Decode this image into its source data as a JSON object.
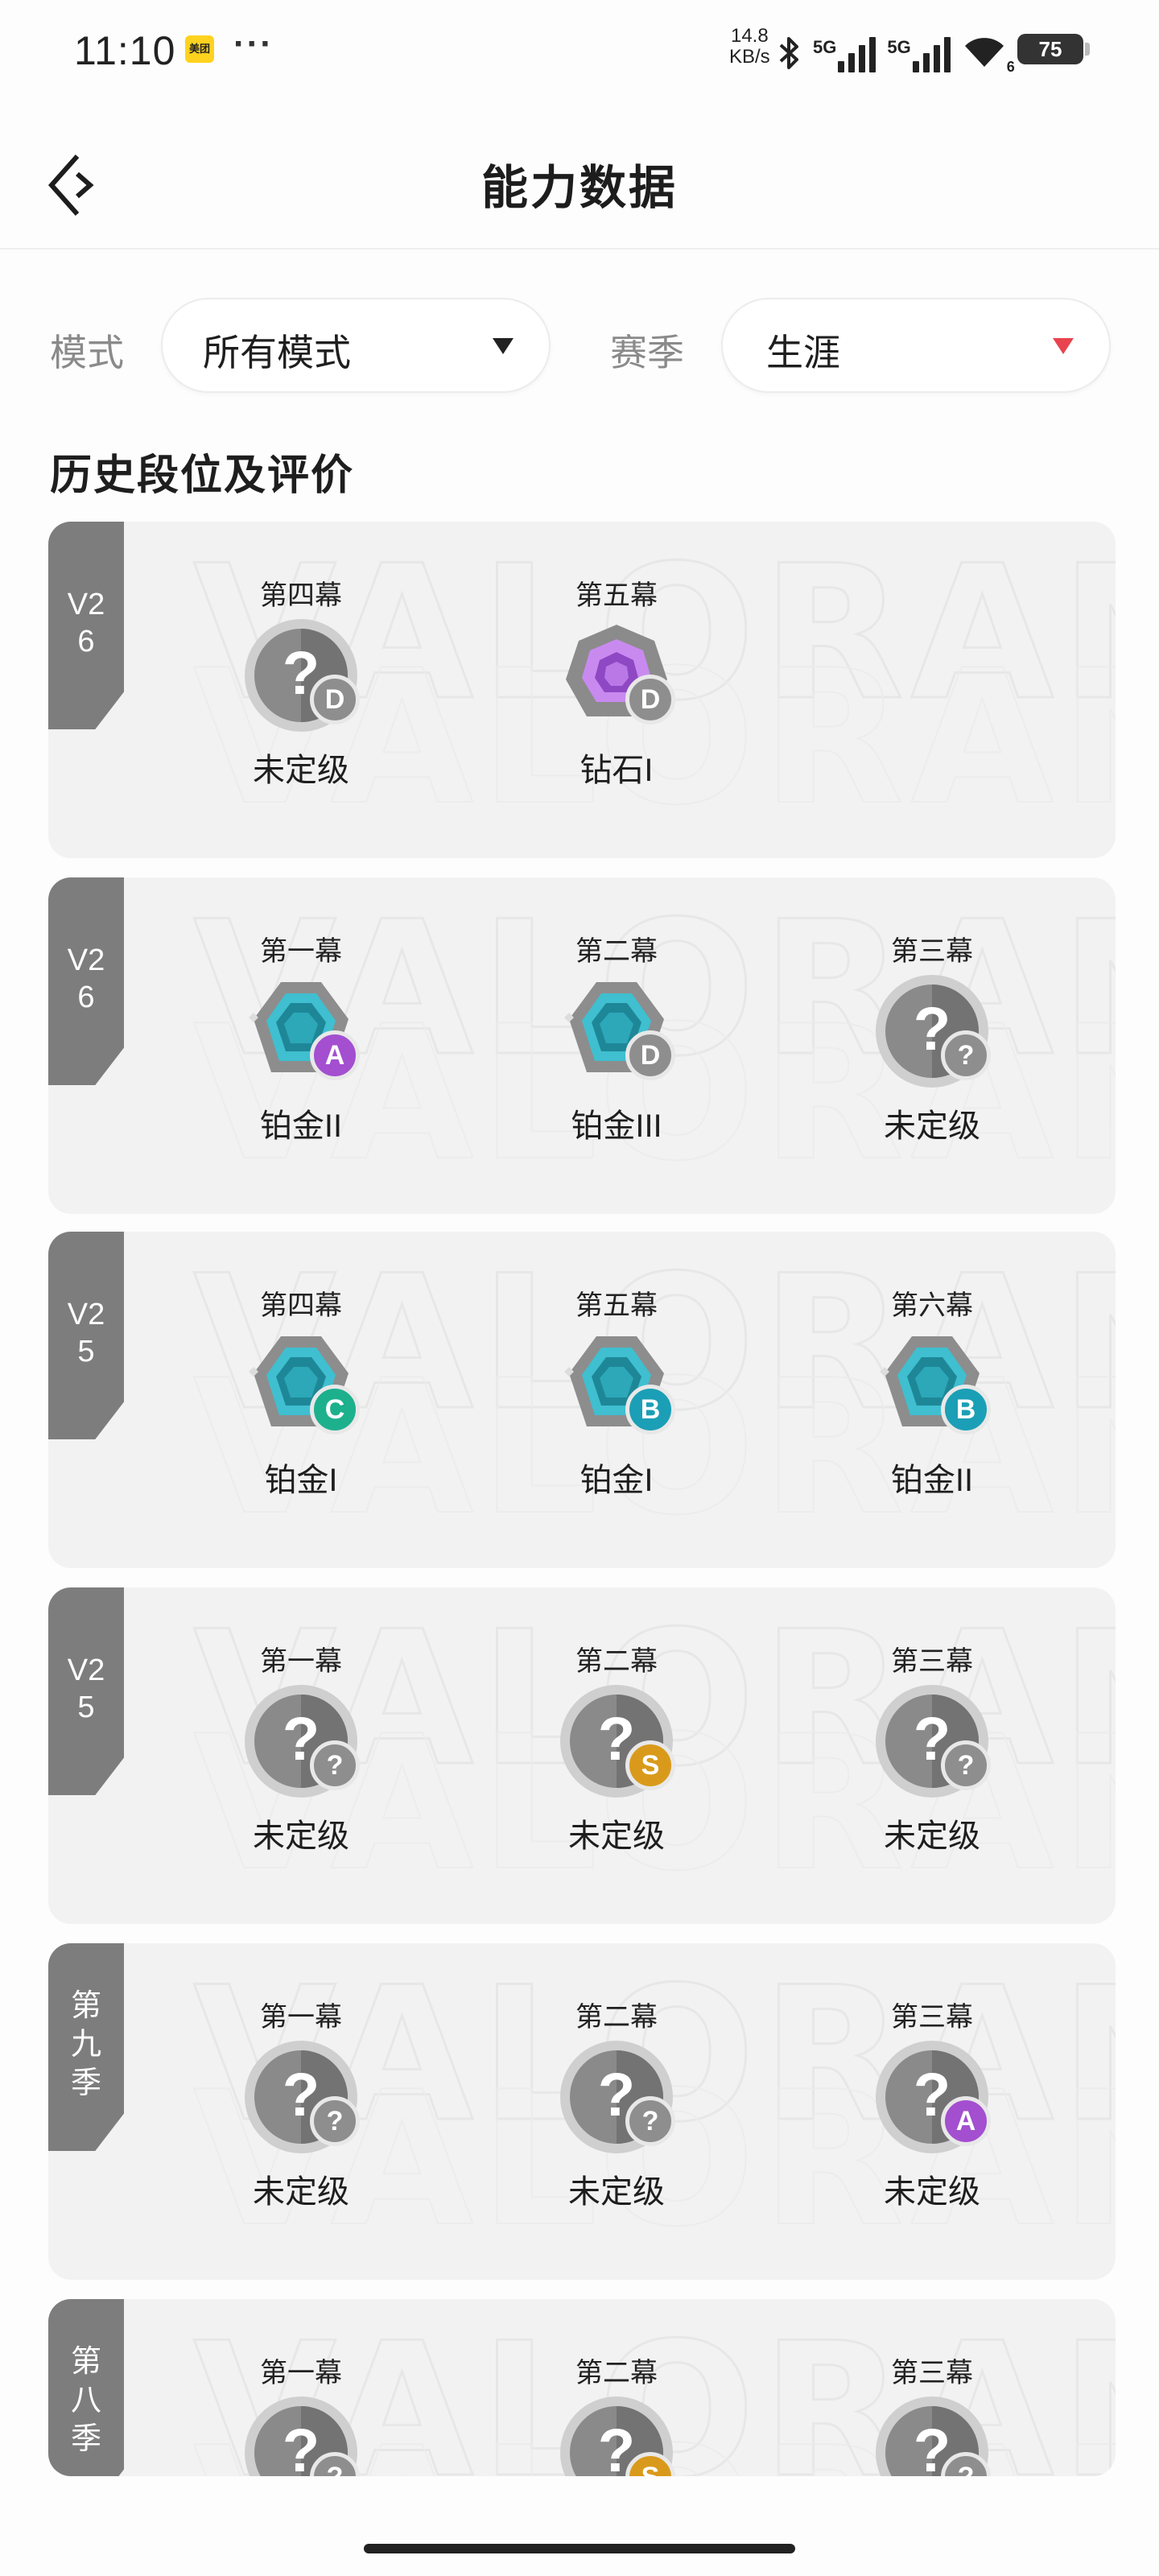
{
  "status_bar": {
    "time": "11:10",
    "app_badge": "美团",
    "more": "···",
    "speed_value": "14.8",
    "speed_unit": "KB/s",
    "network1": "5G",
    "network2": "5G",
    "wifi_sub": "6",
    "battery": "75"
  },
  "header": {
    "title": "能力数据"
  },
  "filters": {
    "mode_label": "模式",
    "mode_value": "所有模式",
    "season_label": "赛季",
    "season_value": "生涯"
  },
  "section_title": "历史段位及评价",
  "watermark": "VALORANT",
  "cards": [
    {
      "season": "V26",
      "acts": [
        {
          "name": "第四幕",
          "rank": "未定级",
          "icon": "unranked-icon",
          "grade": "D"
        },
        {
          "name": "第五幕",
          "rank": "钻石I",
          "icon": "diamond-icon",
          "grade": "D"
        }
      ]
    },
    {
      "season": "V26",
      "acts": [
        {
          "name": "第一幕",
          "rank": "铂金II",
          "icon": "platinum-icon",
          "grade": "A"
        },
        {
          "name": "第二幕",
          "rank": "铂金III",
          "icon": "platinum-icon",
          "grade": "D"
        },
        {
          "name": "第三幕",
          "rank": "未定级",
          "icon": "unranked-icon",
          "grade": "?"
        }
      ]
    },
    {
      "season": "V25",
      "acts": [
        {
          "name": "第四幕",
          "rank": "铂金I",
          "icon": "platinum-icon",
          "grade": "C"
        },
        {
          "name": "第五幕",
          "rank": "铂金I",
          "icon": "platinum-icon",
          "grade": "B"
        },
        {
          "name": "第六幕",
          "rank": "铂金II",
          "icon": "platinum-icon",
          "grade": "B"
        }
      ]
    },
    {
      "season": "V25",
      "acts": [
        {
          "name": "第一幕",
          "rank": "未定级",
          "icon": "unranked-icon",
          "grade": "?"
        },
        {
          "name": "第二幕",
          "rank": "未定级",
          "icon": "unranked-icon",
          "grade": "S"
        },
        {
          "name": "第三幕",
          "rank": "未定级",
          "icon": "unranked-icon",
          "grade": "?"
        }
      ]
    },
    {
      "season": "第九季",
      "acts": [
        {
          "name": "第一幕",
          "rank": "未定级",
          "icon": "unranked-icon",
          "grade": "?"
        },
        {
          "name": "第二幕",
          "rank": "未定级",
          "icon": "unranked-icon",
          "grade": "?"
        },
        {
          "name": "第三幕",
          "rank": "未定级",
          "icon": "unranked-icon",
          "grade": "A"
        }
      ]
    },
    {
      "season": "第八季",
      "acts": [
        {
          "name": "第一幕",
          "rank": "",
          "icon": "unranked-icon",
          "grade": "?"
        },
        {
          "name": "第二幕",
          "rank": "",
          "icon": "unranked-icon",
          "grade": "S"
        },
        {
          "name": "第三幕",
          "rank": "",
          "icon": "unranked-icon",
          "grade": "?"
        }
      ]
    }
  ],
  "colors": {
    "grade_D": "#8e8e8e",
    "grade_A": "#a34fd0",
    "grade_C": "#1db08d",
    "grade_B": "#1b9fb6",
    "grade_S": "#d99a1c",
    "grade_unknown": "#8e8e8e",
    "season_tag": "#7d7d7d",
    "caret_red": "#e8444f"
  }
}
